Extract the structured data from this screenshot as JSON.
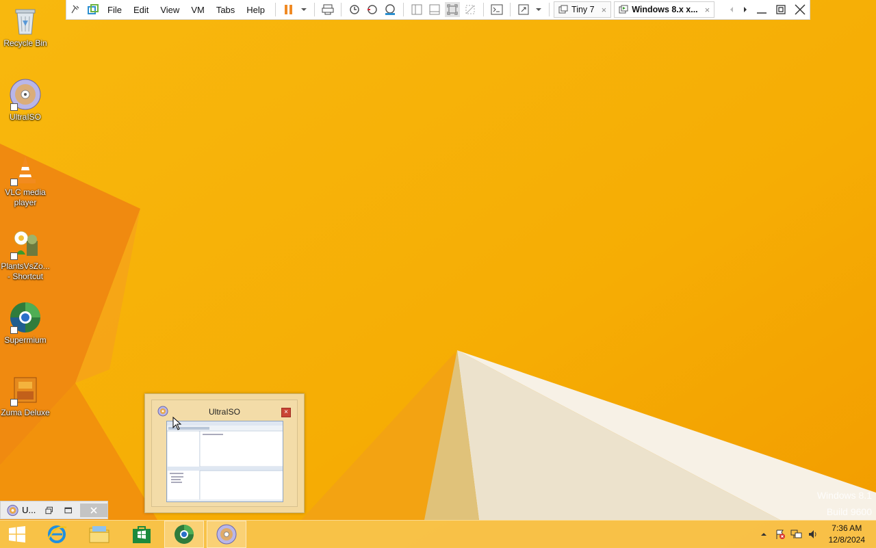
{
  "vm_toolbar": {
    "menus": [
      "File",
      "Edit",
      "View",
      "VM",
      "Tabs",
      "Help"
    ],
    "tabs": [
      {
        "label": "Tiny 7",
        "active": false
      },
      {
        "label": "Windows 8.x x...",
        "active": true
      }
    ],
    "close_glyph": "×"
  },
  "desktop_icons": [
    {
      "label": "Recycle Bin"
    },
    {
      "label": "UltraISO"
    },
    {
      "label": "VLC media player"
    },
    {
      "label": "PlantsVsZo... - Shortcut"
    },
    {
      "label": "Supermium"
    },
    {
      "label": "Zuma Deluxe"
    }
  ],
  "thumbnail": {
    "title": "UltraISO",
    "close": "×"
  },
  "mini_bar": {
    "label": "U..."
  },
  "watermark": {
    "line1": "Windows 8.1",
    "line2": "Build 9600"
  },
  "clock": {
    "time": "7:36 AM",
    "date": "12/8/2024"
  },
  "colors": {
    "accent": "#f7b509",
    "pause": "#f08a24"
  }
}
